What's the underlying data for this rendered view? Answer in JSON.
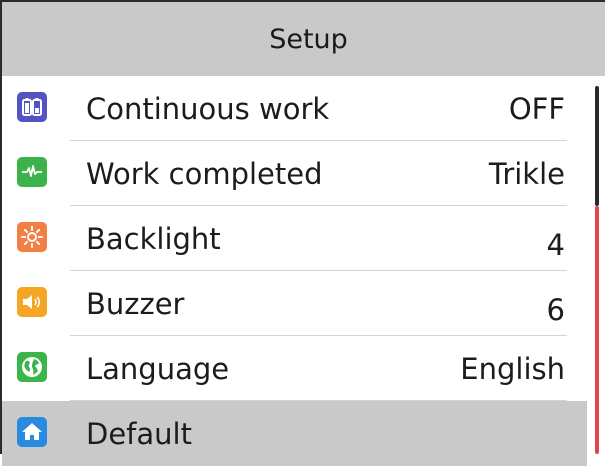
{
  "header": {
    "title": "Setup"
  },
  "colors": {
    "header_bg": "#c9c9c9",
    "selected_bg": "#c9c9c9",
    "scroll_thumb": "#e24646"
  },
  "menu": {
    "items": [
      {
        "label": "Continuous work",
        "value": "OFF",
        "icon": "battery-icon",
        "icon_color": "#5353c6"
      },
      {
        "label": "Work completed",
        "value": "Trikle",
        "icon": "pulse-icon",
        "icon_color": "#3bb34a"
      },
      {
        "label": "Backlight",
        "value": "4",
        "icon": "sun-icon",
        "icon_color": "#f37f44"
      },
      {
        "label": "Buzzer",
        "value": "6",
        "icon": "speaker-icon",
        "icon_color": "#f5a623"
      },
      {
        "label": "Language",
        "value": "English",
        "icon": "globe-icon",
        "icon_color": "#39b54a"
      },
      {
        "label": "Default",
        "value": "",
        "icon": "home-icon",
        "icon_color": "#2a8ae0"
      }
    ],
    "selected_index": 5
  }
}
